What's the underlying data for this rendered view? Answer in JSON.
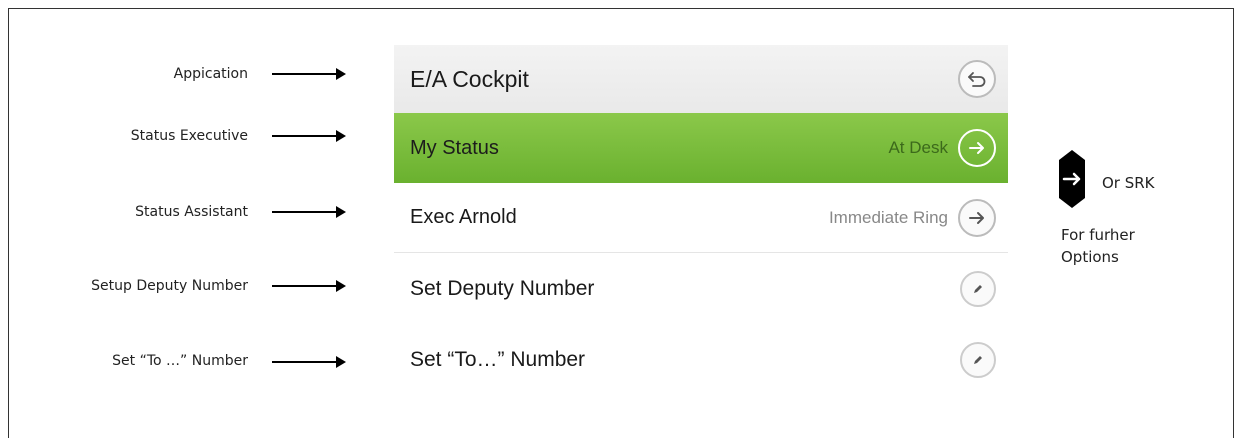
{
  "callouts": [
    {
      "label": "Appication"
    },
    {
      "label": "Status Executive"
    },
    {
      "label": "Status Assistant"
    },
    {
      "label": "Setup Deputy Number"
    },
    {
      "label": "Set “To …” Number"
    }
  ],
  "panel": {
    "header": {
      "title": "E/A Cockpit",
      "icon": "back-arrow-icon"
    },
    "my_status": {
      "title": "My Status",
      "value": "At Desk",
      "icon": "arrow-right-icon",
      "color": "#7cbd3d"
    },
    "exec": {
      "title": "Exec Arnold",
      "value": "Immediate Ring",
      "icon": "arrow-right-icon"
    },
    "deputy": {
      "title": "Set Deputy Number",
      "icon": "pencil-icon"
    },
    "to_number": {
      "title": "Set “To…” Number",
      "icon": "pencil-icon"
    }
  },
  "side": {
    "key_label": "Or SRK",
    "note_line1": "For furher",
    "note_line2": "Options",
    "icon": "navigation-key-icon"
  }
}
